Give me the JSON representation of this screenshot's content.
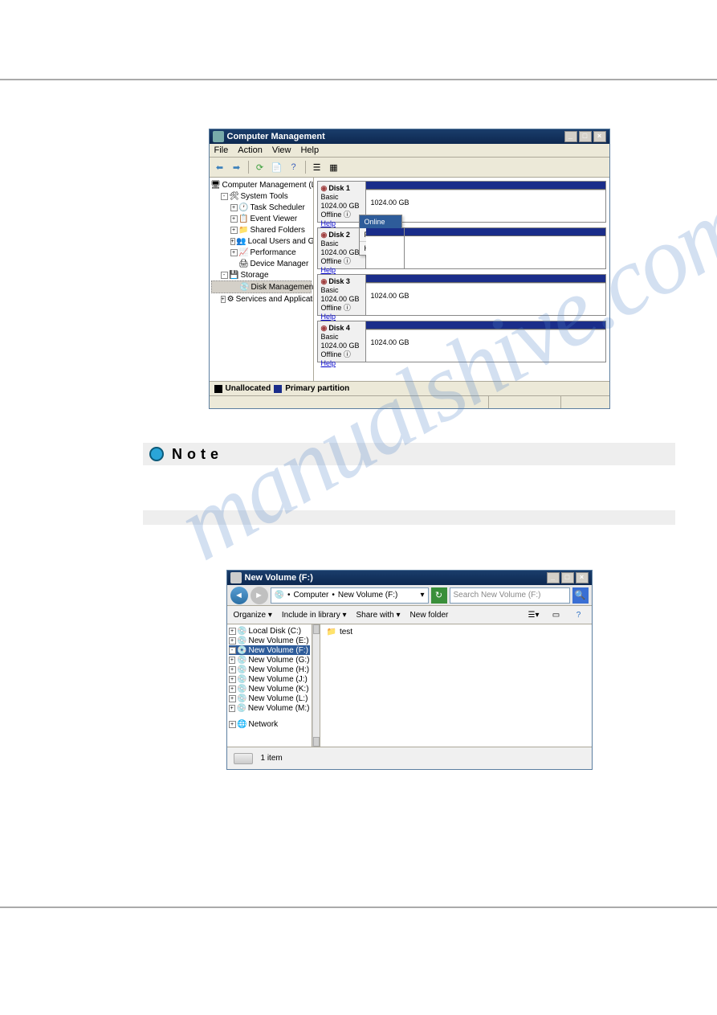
{
  "watermark": "manualshive.com",
  "cm_window": {
    "title": "Computer Management",
    "menu": {
      "file": "File",
      "action": "Action",
      "view": "View",
      "help": "Help"
    },
    "tree": {
      "root": "Computer Management (Local)",
      "system_tools": "System Tools",
      "task_scheduler": "Task Scheduler",
      "event_viewer": "Event Viewer",
      "shared_folders": "Shared Folders",
      "local_users": "Local Users and Groups",
      "performance": "Performance",
      "device_manager": "Device Manager",
      "storage": "Storage",
      "disk_management": "Disk Management",
      "services_apps": "Services and Applications"
    },
    "disks": [
      {
        "name": "Disk 1",
        "type": "Basic",
        "size": "1024.00 GB",
        "status": "Offline",
        "help": "Help",
        "alloc": "1024.00 GB"
      },
      {
        "name": "Disk 2",
        "type": "Basic",
        "size": "1024.00 GB",
        "status": "Offline",
        "help": "Help",
        "alloc": ""
      },
      {
        "name": "Disk 3",
        "type": "Basic",
        "size": "1024.00 GB",
        "status": "Offline",
        "help": "Help",
        "alloc": "1024.00 GB"
      },
      {
        "name": "Disk 4",
        "type": "Basic",
        "size": "1024.00 GB",
        "status": "Offline",
        "help": "Help",
        "alloc": "1024.00 GB"
      }
    ],
    "context_menu": {
      "online": "Online",
      "properties": "Properties",
      "help": "Help"
    },
    "legend": {
      "unalloc": "Unallocated",
      "primary": "Primary partition"
    }
  },
  "note_label": "Note",
  "exp_window": {
    "title": "New Volume (F:)",
    "breadcrumb": {
      "computer": "Computer",
      "sep": " • ",
      "current": "New Volume (F:)"
    },
    "search_placeholder": "Search New Volume (F:)",
    "cmdbar": {
      "organize": "Organize ▾",
      "include": "Include in library ▾",
      "share": "Share with ▾",
      "newfolder": "New folder"
    },
    "tree_items": [
      {
        "label": "Local Disk (C:)",
        "selected": false
      },
      {
        "label": "New Volume (E:)",
        "selected": false
      },
      {
        "label": "New Volume (F:)",
        "selected": true
      },
      {
        "label": "New Volume (G:)",
        "selected": false
      },
      {
        "label": "New Volume (H:)",
        "selected": false
      },
      {
        "label": "New Volume (J:)",
        "selected": false
      },
      {
        "label": "New Volume (K:)",
        "selected": false
      },
      {
        "label": "New Volume (L:)",
        "selected": false
      },
      {
        "label": "New Volume (M:)",
        "selected": false
      }
    ],
    "network": "Network",
    "main_item": "test",
    "status": "1 item"
  }
}
